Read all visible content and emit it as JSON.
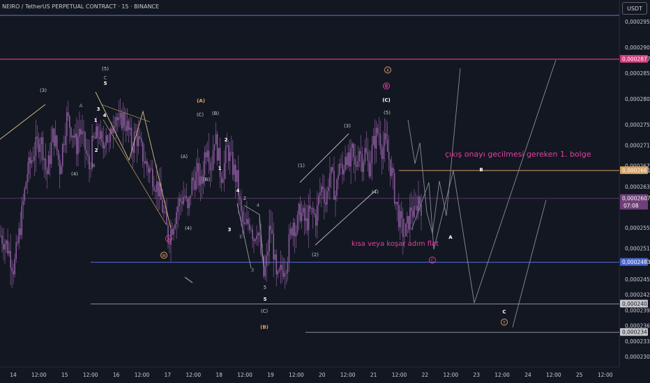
{
  "header": {
    "symbol_title": "NEIRO / TetherUS PERPETUAL CONTRACT · 15 · BINANCE",
    "currency_button": "USDT"
  },
  "colors": {
    "background": "#131722",
    "candle": "#8a5a9c",
    "grid": "#1e222d",
    "axis_text": "#c9ccd4",
    "blue_line": "#4a64c8",
    "pink_line": "#d33a7a",
    "orange_line": "#d6a060",
    "gray_line": "#8a8d96",
    "annotation_pink": "#e040a0",
    "annotation_orange": "#e2a45e"
  },
  "chart_data": {
    "type": "candlestick",
    "price_axis": {
      "range": [
        0.0002295,
        0.0002975
      ],
      "ticks": [
        "0,0002950",
        "0,0002900",
        "0,0002850",
        "0,0002800",
        "0,0002750",
        "0,0002710",
        "0,0002670",
        "0,0002630",
        "0,0002550",
        "0,0002510",
        "0,0002450",
        "0,0002420",
        "0,0002390",
        "0,0002360",
        "0,0002330",
        "0,0002300"
      ]
    },
    "time_axis": {
      "labels": [
        "14",
        "12:00",
        "15",
        "12:00",
        "16",
        "12:00",
        "17",
        "12:00",
        "18",
        "12:00",
        "19",
        "12:00",
        "20",
        "12:00",
        "21",
        "12:00",
        "22",
        "12:00",
        "23",
        "12:00",
        "24",
        "12:00",
        "25",
        "12:00"
      ]
    },
    "price_path": [
      [
        0,
        0.0002535
      ],
      [
        2,
        0.0002515
      ],
      [
        4,
        0.000247
      ],
      [
        6,
        0.0002555
      ],
      [
        8,
        0.0002655
      ],
      [
        10,
        0.0002695
      ],
      [
        12,
        0.0002725
      ],
      [
        13,
        0.00027
      ],
      [
        14,
        0.000265
      ],
      [
        15,
        0.000269
      ],
      [
        16,
        0.0002735
      ],
      [
        17,
        0.0002705
      ],
      [
        18,
        0.0002665
      ],
      [
        19,
        0.0002715
      ],
      [
        20,
        0.0002765
      ],
      [
        22,
        0.0002735
      ],
      [
        23,
        0.0002705
      ],
      [
        24,
        0.0002745
      ],
      [
        26,
        0.0002695
      ],
      [
        27,
        0.0002665
      ],
      [
        28,
        0.0002715
      ],
      [
        30,
        0.0002735
      ],
      [
        31,
        0.0002695
      ],
      [
        32,
        0.0002745
      ],
      [
        33,
        0.0002705
      ],
      [
        34,
        0.0002755
      ],
      [
        35,
        0.0002775
      ],
      [
        36,
        0.0002745
      ],
      [
        37,
        0.0002765
      ],
      [
        38,
        0.0002755
      ],
      [
        39,
        0.0002735
      ],
      [
        40,
        0.0002705
      ],
      [
        41,
        0.0002735
      ],
      [
        42,
        0.0002715
      ],
      [
        44,
        0.0002675
      ],
      [
        46,
        0.0002655
      ],
      [
        48,
        0.0002625
      ],
      [
        50,
        0.0002565
      ],
      [
        51,
        0.000253
      ],
      [
        52,
        0.000255
      ],
      [
        54,
        0.0002595
      ],
      [
        56,
        0.0002615
      ],
      [
        57,
        0.0002575
      ],
      [
        58,
        0.0002635
      ],
      [
        60,
        0.0002655
      ],
      [
        61,
        0.0002625
      ],
      [
        62,
        0.000269
      ],
      [
        63,
        0.000272
      ],
      [
        64,
        0.000266
      ],
      [
        65,
        0.000273
      ],
      [
        66,
        0.00027
      ],
      [
        67,
        0.000265
      ],
      [
        68,
        0.000267
      ],
      [
        69,
        0.0002705
      ],
      [
        70,
        0.000268
      ],
      [
        72,
        0.000264
      ],
      [
        73,
        0.000258
      ],
      [
        74,
        0.0002545
      ],
      [
        76,
        0.0002565
      ],
      [
        77,
        0.000253
      ],
      [
        78,
        0.0002555
      ],
      [
        79,
        0.000251
      ],
      [
        80,
        0.0002455
      ],
      [
        81,
        0.0002485
      ],
      [
        82,
        0.000256
      ],
      [
        83,
        0.000251
      ],
      [
        84,
        0.000244
      ],
      [
        85,
        0.000246
      ],
      [
        87,
        0.0002485
      ],
      [
        88,
        0.000253
      ],
      [
        89,
        0.0002565
      ],
      [
        90,
        0.0002545
      ],
      [
        91,
        0.0002585
      ],
      [
        93,
        0.0002555
      ],
      [
        94,
        0.000258
      ],
      [
        96,
        0.000257
      ],
      [
        97,
        0.0002615
      ],
      [
        98,
        0.0002635
      ],
      [
        99,
        0.0002595
      ],
      [
        100,
        0.000266
      ],
      [
        101,
        0.000264
      ],
      [
        102,
        0.000261
      ],
      [
        103,
        0.000268
      ],
      [
        104,
        0.000265
      ],
      [
        105,
        0.0002705
      ],
      [
        106,
        0.0002665
      ],
      [
        107,
        0.0002695
      ],
      [
        108,
        0.000266
      ],
      [
        109,
        0.000271
      ],
      [
        110,
        0.000268
      ],
      [
        111,
        0.00027
      ],
      [
        112,
        0.0002665
      ],
      [
        113,
        0.00027
      ],
      [
        114,
        0.0002725
      ],
      [
        115,
        0.000274
      ],
      [
        116,
        0.0002705
      ],
      [
        117,
        0.0002715
      ],
      [
        118,
        0.000269
      ],
      [
        119,
        0.0002655
      ],
      [
        120,
        0.000261
      ],
      [
        121,
        0.0002575
      ],
      [
        122,
        0.000255
      ],
      [
        123,
        0.0002535
      ],
      [
        124,
        0.000256
      ],
      [
        125,
        0.000259
      ],
      [
        126,
        0.000257
      ],
      [
        127,
        0.000261
      ],
      [
        128,
        0.0002595
      ]
    ],
    "horizontal_levels": [
      {
        "price": 0.0002962,
        "style": "blue",
        "label": ""
      },
      {
        "price": 0.0002877,
        "style": "pink",
        "label": "0,0002877"
      },
      {
        "price": 0.0002661,
        "style": "orange",
        "label": "0,0002661"
      },
      {
        "price": 0.0002607,
        "style": "dim",
        "label": "0,0002607",
        "sub": "07:08"
      },
      {
        "price": 0.0002483,
        "style": "blue",
        "label": "0,0002483"
      },
      {
        "price": 0.0002402,
        "style": "gray",
        "label": "0,0002402"
      },
      {
        "price": 0.0002347,
        "style": "gray",
        "label": "0,0002347"
      }
    ],
    "annotations": [
      {
        "text": "çıkış onayı  gecilmesi gereken  1. bolge",
        "color": "pink"
      },
      {
        "text": "kısa veya koşar adım flat",
        "color": "pink"
      }
    ],
    "wave_labels": [
      "(3)",
      "A",
      "3",
      "1",
      "4",
      "2",
      "B",
      "(4)",
      "(5)",
      "C",
      "5",
      "(A)",
      "(C)",
      "(B)",
      "2",
      "1",
      "(A)",
      "(B)",
      "4",
      "2",
      "3",
      "1",
      "4",
      "3",
      "5",
      "5",
      "(C)",
      "(B)",
      "(1)",
      "(2)",
      "(3)",
      "(4)",
      "(5)",
      "(C)",
      "c",
      "(B)",
      "B",
      "A",
      "C",
      "(4)",
      "(A)",
      "(W)",
      "X",
      "B",
      "C",
      "Y"
    ]
  }
}
